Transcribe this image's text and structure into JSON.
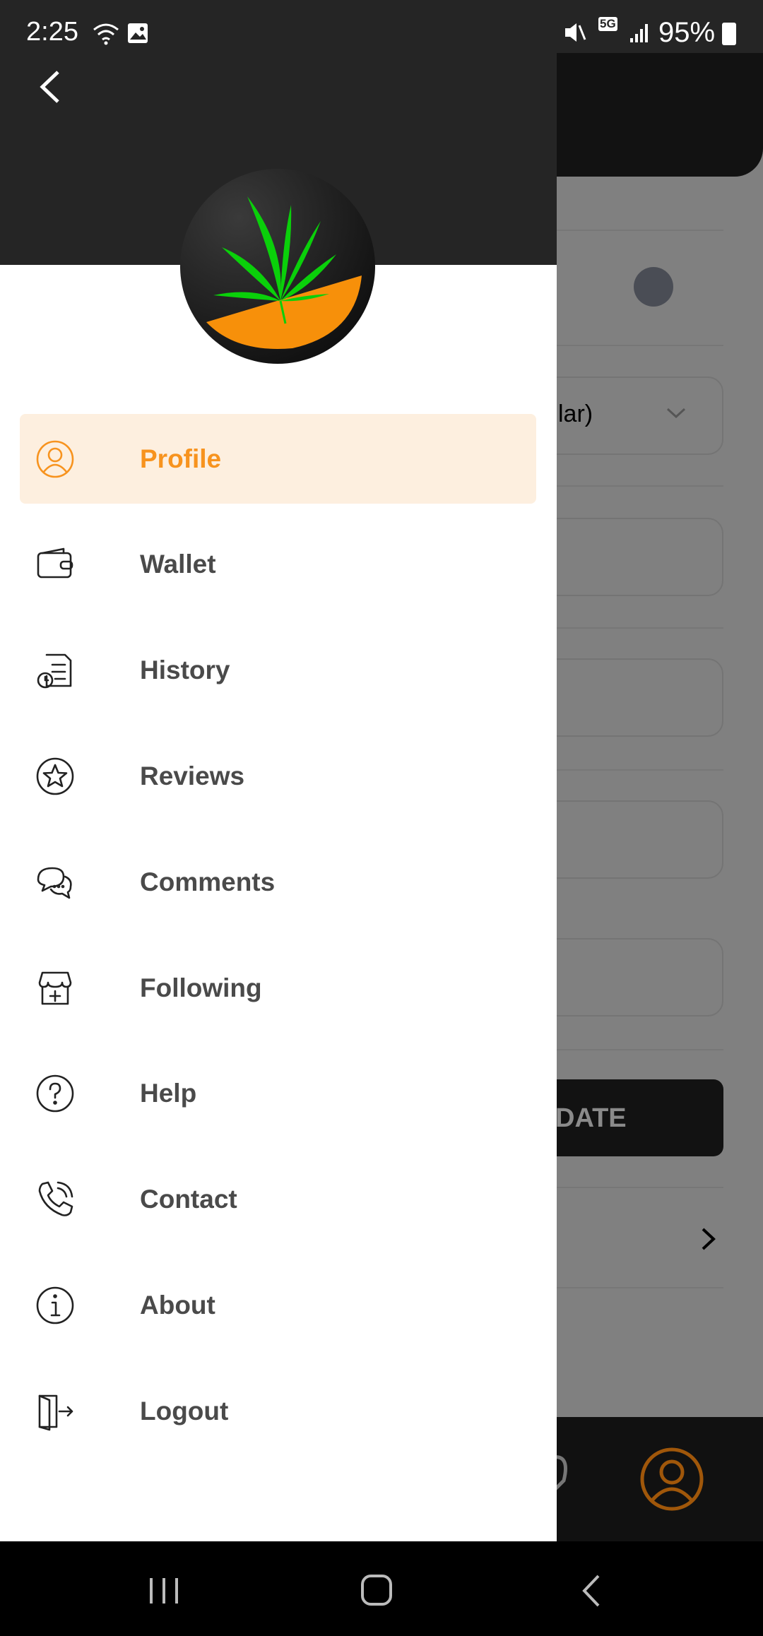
{
  "status_bar": {
    "time": "2:25",
    "battery": "95%",
    "network": "5G"
  },
  "drawer": {
    "menu": [
      {
        "label": "Profile",
        "icon": "profile-icon",
        "active": true
      },
      {
        "label": "Wallet",
        "icon": "wallet-icon"
      },
      {
        "label": "History",
        "icon": "history-icon"
      },
      {
        "label": "Reviews",
        "icon": "star-icon"
      },
      {
        "label": "Comments",
        "icon": "comments-icon"
      },
      {
        "label": "Following",
        "icon": "store-icon"
      },
      {
        "label": "Help",
        "icon": "help-icon"
      },
      {
        "label": "Contact",
        "icon": "phone-icon"
      },
      {
        "label": "About",
        "icon": "info-icon"
      },
      {
        "label": "Logout",
        "icon": "logout-icon"
      }
    ]
  },
  "background": {
    "dropdown_partial": "lar)",
    "button_partial": "DATE"
  },
  "colors": {
    "accent": "#f7931e",
    "header": "#252525",
    "overlay": "#808080"
  }
}
